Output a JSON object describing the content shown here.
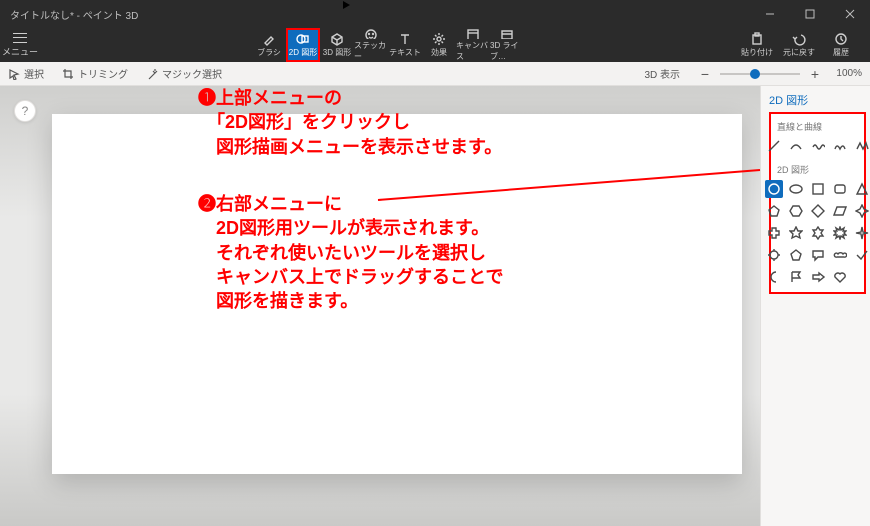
{
  "titlebar": {
    "title": "タイトルなし* - ペイント 3D"
  },
  "menu": {
    "label": "メニュー"
  },
  "tools": [
    {
      "id": "brush",
      "label": "ブラシ"
    },
    {
      "id": "2dshape",
      "label": "2D 図形",
      "selected": true
    },
    {
      "id": "3dshape",
      "label": "3D 図形"
    },
    {
      "id": "sticker",
      "label": "ステッカー"
    },
    {
      "id": "text",
      "label": "テキスト"
    },
    {
      "id": "effect",
      "label": "効果"
    },
    {
      "id": "canvas",
      "label": "キャンバス"
    },
    {
      "id": "3dlib",
      "label": "3D ライブ…"
    }
  ],
  "rightTools": [
    {
      "id": "paste",
      "label": "貼り付け"
    },
    {
      "id": "undo",
      "label": "元に戻す"
    },
    {
      "id": "history",
      "label": "履歴"
    }
  ],
  "ribbon": {
    "select": "選択",
    "trim": "トリミング",
    "magic": "マジック選択",
    "view3d": "3D 表示",
    "zoom": "100%"
  },
  "panel": {
    "title": "2D 図形",
    "section1": "直線と曲線",
    "section2": "2D 図形",
    "lines": [
      "line-diag",
      "arc",
      "wave",
      "tri-curve",
      "polyline"
    ],
    "shapes": [
      "circle",
      "oval",
      "square",
      "rect-round",
      "triangle",
      "pentagon",
      "hexagon",
      "diamond",
      "rhombus",
      "star4",
      "cross",
      "star5",
      "star6",
      "burst",
      "sparkle",
      "gear",
      "pentagon2",
      "speech",
      "cloud",
      "check",
      "moon",
      "flag",
      "arrow-r",
      "heart",
      "blank"
    ],
    "selectedShape": "circle"
  },
  "annotations": {
    "a1": "❶上部メニューの\n　「2D図形」をクリックし\n　図形描画メニューを表示させます。",
    "a2": "❷右部メニューに\n　2D図形用ツールが表示されます。\n　それぞれ使いたいツールを選択し\n　キャンバス上でドラッグすることで\n　図形を描きます。"
  },
  "help": "?"
}
